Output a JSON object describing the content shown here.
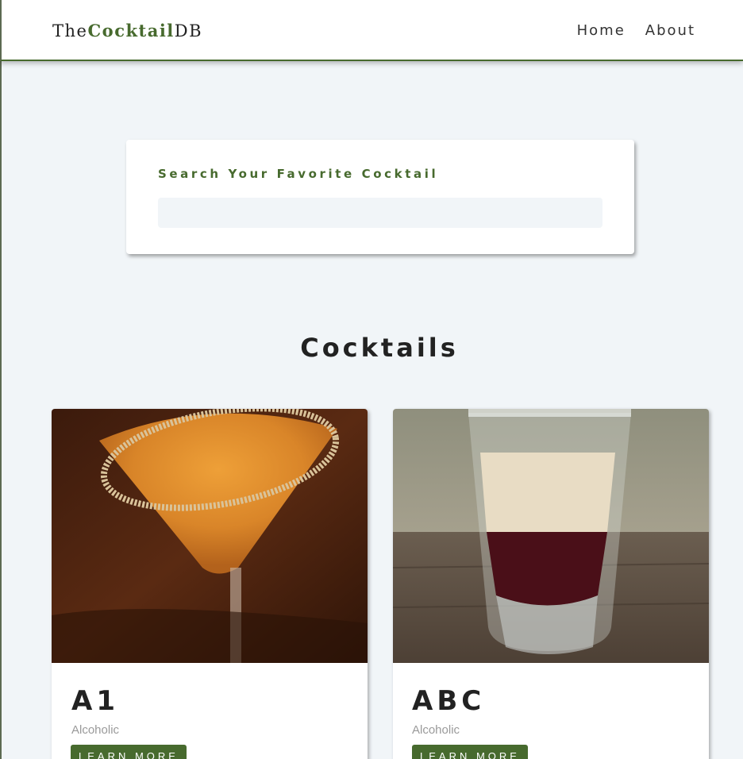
{
  "navbar": {
    "logo_prefix": "The",
    "logo_accent": "Cocktail",
    "logo_suffix": "DB",
    "links": [
      "Home",
      "About"
    ]
  },
  "search": {
    "label": "Search Your Favorite Cocktail",
    "value": "",
    "placeholder": ""
  },
  "section": {
    "title": "Cocktails"
  },
  "cocktails": [
    {
      "name": "A1",
      "type": "Alcoholic",
      "button": "Learn More"
    },
    {
      "name": "ABC",
      "type": "Alcoholic",
      "button": "Learn More"
    }
  ],
  "colors": {
    "accent": "#476a2e",
    "background": "#f1f5f8",
    "card": "#ffffff",
    "text_dark": "#222222",
    "text_muted": "#9a9a9a"
  }
}
